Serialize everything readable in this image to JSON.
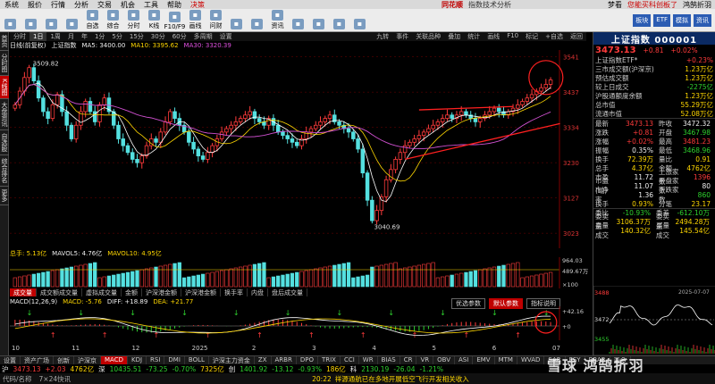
{
  "menubar": {
    "items": [
      "系统",
      "报价",
      "行情",
      "分析",
      "交易",
      "机会",
      "工具",
      "帮助",
      "决策"
    ],
    "brand": "同花顺",
    "subtitle": "指数技术分析",
    "right": [
      "梦看",
      "您能买科创板了",
      "鸿鹄折羽"
    ]
  },
  "toolbar": {
    "buttons": [
      {
        "label": "",
        "icon": "home-icon"
      },
      {
        "label": "",
        "icon": "back-icon"
      },
      {
        "label": "",
        "icon": "forward-icon"
      },
      {
        "label": "",
        "icon": "refresh-icon"
      },
      {
        "label": "自选",
        "icon": "star-icon"
      },
      {
        "label": "综合",
        "icon": "grid-icon"
      },
      {
        "label": "分时",
        "icon": "line-icon"
      },
      {
        "label": "K线",
        "icon": "candle-icon"
      },
      {
        "label": "F10/F9",
        "icon": "doc-icon"
      },
      {
        "label": "画线",
        "icon": "pen-icon"
      },
      {
        "label": "问财",
        "icon": "chat-icon"
      },
      {
        "label": "",
        "icon": "ruler-icon"
      },
      {
        "label": "",
        "icon": "target-icon"
      },
      {
        "label": "资讯",
        "icon": "news-icon"
      },
      {
        "label": "",
        "icon": "bell-icon"
      },
      {
        "label": "",
        "icon": "list-icon"
      },
      {
        "label": "",
        "icon": "mail-icon"
      },
      {
        "label": "",
        "icon": "user-icon"
      }
    ],
    "ads": [
      "板块",
      "ETF",
      "模拟",
      "资讯"
    ]
  },
  "leftbar": [
    "首页",
    "分时图",
    "K线图",
    "大盘资讯",
    "自选股",
    "综合排名",
    "更多"
  ],
  "periodbar": {
    "items": [
      "分时",
      "1日",
      "1周",
      "月",
      "年",
      "1分",
      "5分",
      "15分",
      "30分",
      "60分",
      "多周期",
      "设置"
    ],
    "active": "1日",
    "right": [
      "九转",
      "事件",
      "关联品种",
      "叠加",
      "统计",
      "画线",
      "F10",
      "标记",
      "+自选",
      "返回"
    ]
  },
  "chartinfo": {
    "mode": "日线(前复权)",
    "name": "上证指数",
    "ma5": "MA5: 3400.00",
    "ma10": "MA10: 3395.62",
    "ma30": "MA30: 3320.39"
  },
  "chart_data": {
    "type": "candlestick",
    "ylim": [
      3000,
      3545
    ],
    "y_ticks": [
      3541,
      3437,
      3334,
      3230,
      3127,
      3023
    ],
    "x_ticks": [
      "10",
      "11",
      "12",
      "2025",
      "2",
      "3",
      "4",
      "5",
      "6",
      "07"
    ],
    "annotations": [
      "3509.82",
      "3040.69"
    ],
    "close_path": [
      3400,
      3440,
      3480,
      3509,
      3470,
      3420,
      3380,
      3360,
      3400,
      3430,
      3380,
      3340,
      3300,
      3340,
      3380,
      3410,
      3380,
      3350,
      3400,
      3420,
      3380,
      3340,
      3300,
      3280,
      3260,
      3240,
      3230,
      3250,
      3280,
      3300,
      3290,
      3320,
      3350,
      3380,
      3360,
      3340,
      3320,
      3290,
      3270,
      3250,
      3240,
      3260,
      3280,
      3300,
      3320,
      3330,
      3340,
      3350,
      3360,
      3370,
      3380,
      3360,
      3350,
      3340,
      3360,
      3340,
      3320,
      3310,
      3300,
      3290,
      3280,
      3300,
      3320,
      3330,
      3340,
      3350,
      3360,
      3370,
      3350,
      3340,
      3330,
      3320,
      3300,
      3270,
      3200,
      3120,
      3060,
      3090,
      3130,
      3180,
      3210,
      3240,
      3260,
      3280,
      3290,
      3300,
      3310,
      3320,
      3330,
      3340,
      3350,
      3360,
      3370,
      3360,
      3370,
      3380,
      3370,
      3360,
      3350,
      3360,
      3370,
      3380,
      3390,
      3380,
      3370,
      3380,
      3390,
      3400,
      3410,
      3420,
      3430,
      3440,
      3450,
      3460,
      3473
    ]
  },
  "volume": {
    "label": "总手: 5.13亿",
    "mavol5": "MAVOL5: 4.76亿",
    "mavol10": "MAVOL10: 4.95亿",
    "ticks": [
      "964.03",
      "489.67万",
      "×100"
    ]
  },
  "tabs": [
    "成交量",
    "成交额成交量",
    "虚拟成交量",
    "金额",
    "沪深港金额",
    "沪深港金额",
    "换手率",
    "内盘",
    "盘后成交量"
  ],
  "macd": {
    "label": "MACD(12,26,9)",
    "macd": "MACD: -5.76",
    "diff": "DIFF: +18.89",
    "dea": "DEA: +21.77",
    "btn_optimize": "优选参数",
    "btn_default": "默认参数",
    "btn_help": "指标说明",
    "ticks": [
      "+42.16",
      "+0"
    ]
  },
  "bottomtabs": [
    "设置",
    "资产广场",
    "创新",
    "沪深京",
    "MACD",
    "KDJ",
    "RSI",
    "DMI",
    "BOLL",
    "沪深主力资金",
    "ZX",
    "ARBR",
    "DPO",
    "TRIX",
    "CCI",
    "WR",
    "BIAS",
    "CR",
    "VR",
    "OBV",
    "ASI",
    "EMV",
    "MTM",
    "WVAD",
    "SAR",
    "PSY",
    "BRAR",
    "更多"
  ],
  "ticker": [
    {
      "t": "沪",
      "c": "white"
    },
    {
      "t": "3473.13",
      "c": "red"
    },
    {
      "t": "+2.03",
      "c": "red"
    },
    {
      "t": "4762亿",
      "c": "yellow"
    },
    {
      "t": "深",
      "c": "white"
    },
    {
      "t": "10435.51",
      "c": "green"
    },
    {
      "t": "-73.25",
      "c": "green"
    },
    {
      "t": "-0.70%",
      "c": "green"
    },
    {
      "t": "7325亿",
      "c": "yellow"
    },
    {
      "t": "创",
      "c": "white"
    },
    {
      "t": "1401.92",
      "c": "green"
    },
    {
      "t": "-13.12",
      "c": "green"
    },
    {
      "t": "-0.93%",
      "c": "green"
    },
    {
      "t": "186亿",
      "c": "yellow"
    },
    {
      "t": "科",
      "c": "white"
    },
    {
      "t": "2130.19",
      "c": "green"
    },
    {
      "t": "-26.04",
      "c": "green"
    },
    {
      "t": "-1.21%",
      "c": "green"
    }
  ],
  "statusbar": {
    "left": "代码/名称",
    "right": "7×24快讯",
    "time": "20:22",
    "news": "祥源通航已在多地开展低空飞行开发相关收入"
  },
  "rightpanel": {
    "title": "上证指数 000001",
    "price": "3473.13",
    "change": "+0.81",
    "pct": "+0.02%",
    "rows1": [
      {
        "l": "上证指数ETF*",
        "v": "+0.23%",
        "c": "red"
      },
      {
        "l": "三市成交额(沪深京)",
        "v": "1.23万亿",
        "c": "yellow"
      },
      {
        "l": "预估成交额",
        "v": "1.23万亿",
        "c": "yellow"
      },
      {
        "l": "较上日成交",
        "v": "-2275亿",
        "c": "green"
      },
      {
        "l": "沪股通额度余额",
        "v": "1.23万亿",
        "c": "yellow"
      },
      {
        "l": "总市值",
        "v": "55.29万亿",
        "c": "yellow"
      },
      {
        "l": "流通市值",
        "v": "52.08万亿",
        "c": "yellow"
      }
    ],
    "rows2": [
      {
        "a": "最新",
        "av": "3473.13",
        "ac": "red",
        "b": "昨收",
        "bv": "3472.32",
        "bc": "white"
      },
      {
        "a": "涨跌",
        "av": "+0.81",
        "ac": "red",
        "b": "开盘",
        "bv": "3467.98",
        "bc": "green"
      },
      {
        "a": "涨幅",
        "av": "+0.02%",
        "ac": "red",
        "b": "最高",
        "bv": "3481.23",
        "bc": "red"
      },
      {
        "a": "振幅",
        "av": "0.35%",
        "ac": "white",
        "b": "最低",
        "bv": "3468.96",
        "bc": "green"
      },
      {
        "a": "换手",
        "av": "72.39万",
        "ac": "yellow",
        "b": "量比",
        "bv": "0.91",
        "bc": "yellow"
      },
      {
        "a": "总手",
        "av": "4.37亿",
        "ac": "yellow",
        "b": "金额",
        "bv": "4762亿",
        "bc": "yellow"
      },
      {
        "a": "市盈",
        "av": "11.72",
        "ac": "white",
        "b": "上涨家数",
        "bv": "1396",
        "bc": "red"
      },
      {
        "a": "市盈(动)",
        "av": "11.07",
        "ac": "white",
        "b": "平盘家数",
        "bv": "80",
        "bc": "white"
      },
      {
        "a": "市净率",
        "av": "1.36",
        "ac": "white",
        "b": "下跌家数",
        "bv": "860",
        "bc": "green"
      },
      {
        "a": "换手",
        "av": "0.93%",
        "ac": "yellow",
        "b": "分笔",
        "bv": "23.17",
        "bc": "yellow"
      }
    ],
    "weibi": "委比",
    "weibi_v": "-10.93%",
    "weicha": "委差",
    "weicha_v": "-612.10万",
    "buy": "委卖量",
    "buy_v": "3106.37万",
    "sell": "委买量",
    "sell_v": "2494.28万",
    "ss_l": "卖量成交",
    "ss_v": "140.32亿",
    "bs_l": "买量成交",
    "bs_v": "145.54亿",
    "mini_ticks": [
      "3488",
      "3472",
      "3455"
    ],
    "mini_date": "2025-07-07"
  },
  "watermark": "雪球 鸿鹄折羽"
}
